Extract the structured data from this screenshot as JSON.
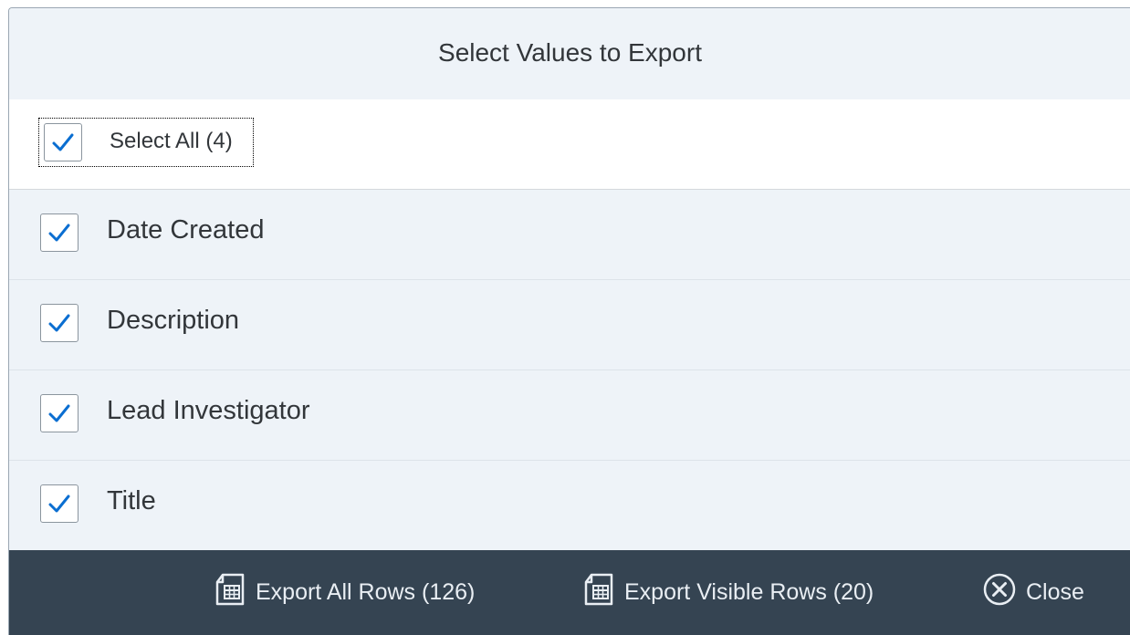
{
  "dialog": {
    "title": "Select Values to Export"
  },
  "select_all": {
    "label": "Select All (4)",
    "checked": true
  },
  "items": [
    {
      "label": "Date Created",
      "checked": true
    },
    {
      "label": "Description",
      "checked": true
    },
    {
      "label": "Lead Investigator",
      "checked": true
    },
    {
      "label": "Title",
      "checked": true
    }
  ],
  "footer": {
    "export_all_label": "Export All Rows (126)",
    "export_all_icon": "spreadsheet-export-icon",
    "export_visible_label": "Export Visible Rows (20)",
    "export_visible_icon": "spreadsheet-export-icon",
    "close_label": "Close",
    "close_icon": "close-circle-icon"
  },
  "colors": {
    "header_bg": "#eef3f8",
    "footer_bg": "#354452",
    "check_color": "#0a6ed1",
    "text": "#32363a"
  }
}
